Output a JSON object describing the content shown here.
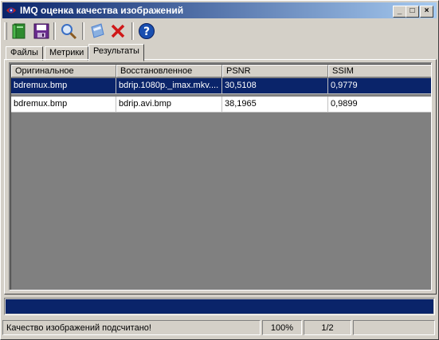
{
  "window": {
    "title": "IMQ оценка качества изображений",
    "controls": {
      "minimize": "_",
      "maximize": "□",
      "close": "×"
    }
  },
  "toolbar": {
    "buttons": [
      {
        "name": "open-book-icon",
        "color": "#2e8b2e"
      },
      {
        "name": "save-icon",
        "color": "#6a2c8f"
      },
      {
        "name": "search-icon",
        "color": "#3a6fc4"
      },
      {
        "name": "calculator-icon",
        "color": "#4a7fd0"
      },
      {
        "name": "delete-icon",
        "color": "#d01818"
      },
      {
        "name": "help-icon",
        "color": "#1a4fb0"
      }
    ]
  },
  "tabs": [
    {
      "label": "Файлы",
      "active": false
    },
    {
      "label": "Метрики",
      "active": false
    },
    {
      "label": "Результаты",
      "active": true
    }
  ],
  "table": {
    "columns": [
      "Оригинальное",
      "Восстановленное",
      "PSNR",
      "SSIM"
    ],
    "rows": [
      {
        "original": "bdremux.bmp",
        "restored": "bdrip.1080p._imax.mkv....",
        "psnr": "30,5108",
        "ssim": "0,9779",
        "selected": true
      },
      {
        "original": "bdremux.bmp",
        "restored": "bdrip.avi.bmp",
        "psnr": "38,1965",
        "ssim": "0,9899",
        "selected": false
      }
    ]
  },
  "progress": {
    "value": 1.0,
    "color": "#0a246a"
  },
  "status": {
    "message": "Качество изображений подсчитано!",
    "percent": "100%",
    "count": "1/2",
    "extra": ""
  }
}
